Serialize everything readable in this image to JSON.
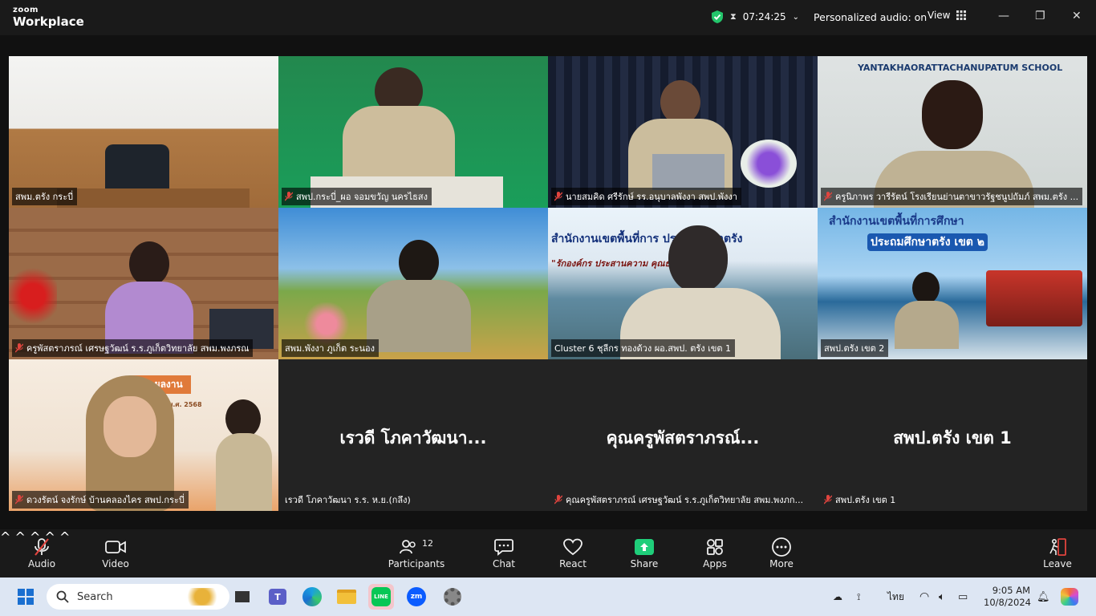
{
  "window": {
    "brand_top": "zoom",
    "brand_bottom": "Workplace",
    "meeting_timer": "07:24:25",
    "audio_status": "Personalized audio: on",
    "view_label": "View",
    "minimize_glyph": "—",
    "maximize_glyph": "❐",
    "close_glyph": "✕"
  },
  "tiles": [
    {
      "name": "สพม.ตรัง กระบี่",
      "muted": false
    },
    {
      "name": "สพป.กระบี่_ผอ จอมขวัญ นครไธสง",
      "muted": true
    },
    {
      "name": "นายสมคิด ศรีรักษ์ รร.อนุบาลพังงา สพป.พังงา",
      "muted": true
    },
    {
      "name": "ครูนิภาพร วารีรัตน์ โรงเรียนย่านตาขาวรัฐชนูปถัมภ์ สพม.ตรัง ...",
      "muted": true,
      "sign": "YANTAKHAORATTACHANUPATUM SCHOOL"
    },
    {
      "name": "ครูพัสตราภรณ์ เศรษฐวัฒน์ ร.ร.ภูเก็ตวิทยาลัย สพม.พงภรณ",
      "muted": true
    },
    {
      "name": "สพม.พังงา ภูเก็ต ระนอง",
      "muted": false
    },
    {
      "name": "Cluster 6 ชุลีกร  ทองด้วง ผอ.สพป. ตรัง เขต 1",
      "muted": false,
      "active": true,
      "sign": "สำนักงานเขตพื้นที่การ   ประถมศึกษาตรัง",
      "sign2": "\"รักองค์กร ประสานความ        คุณธรรม ก้าวนำสู่"
    },
    {
      "name": "สพป.ตรัง เขต 2",
      "muted": false,
      "sign": "สำนักงานเขตพื้นที่การศึกษา",
      "sign2": "ประถมศึกษาตรัง เขต ๒"
    },
    {
      "name": "ดวงรัตน์ จงรักษ์  บ้านคลองไคร  สพป.กระบี่",
      "muted": true,
      "sign": "และผลงาน",
      "sign2": "2 ประจำปี พ.ศ. 2568"
    },
    {
      "name": "เรวดี โภคาวัฒนา ร.ร. ห.ย.(กลึง)",
      "muted": false,
      "display": "เรวดี โภคาวัฒนา..."
    },
    {
      "name": "คุณครูพัสตราภรณ์ เศรษฐวัฒน์ ร.ร.ภูเก็ตวิทยาลัย สพม.พงภก...",
      "muted": true,
      "display": "คุณครูพัสตราภรณ์..."
    },
    {
      "name": "สพป.ตรัง เขต 1",
      "muted": true,
      "display": "สพป.ตรัง เขต 1"
    }
  ],
  "toolbar": {
    "audio": "Audio",
    "video": "Video",
    "participants": "Participants",
    "participants_count": "12",
    "chat": "Chat",
    "react": "React",
    "share": "Share",
    "apps": "Apps",
    "more": "More",
    "leave": "Leave"
  },
  "taskbar": {
    "search_placeholder": "Search",
    "lang": "ไทย",
    "time": "9:05 AM",
    "date": "10/8/2024",
    "line_label": "LINE",
    "zoom_label": "zm"
  },
  "colors": {
    "active_border": "#2fd08f",
    "share_green": "#1fce7a",
    "muted_red": "#e0443e"
  }
}
